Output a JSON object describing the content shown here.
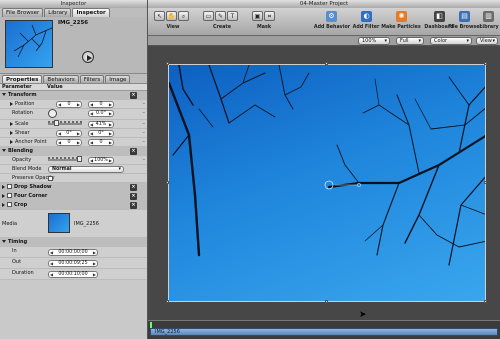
{
  "inspector": {
    "title": "Inspector",
    "top_tabs": [
      "File Browser",
      "Library",
      "Inspector"
    ],
    "clip_name": "IMG_2256",
    "sub_tabs": [
      "Properties",
      "Behaviors",
      "Filters",
      "Image"
    ],
    "columns": {
      "param": "Parameter",
      "value": "Value"
    },
    "transform": {
      "label": "Transform",
      "position": {
        "label": "Position",
        "x": "0",
        "y": "0"
      },
      "rotation": {
        "label": "Rotation",
        "value": "0.0°"
      },
      "scale": {
        "label": "Scale",
        "value": "41%"
      },
      "shear": {
        "label": "Shear",
        "x": "0°",
        "y": "0°"
      },
      "anchor": {
        "label": "Anchor Point",
        "x": "0",
        "y": "0"
      }
    },
    "blending": {
      "label": "Blending",
      "opacity": {
        "label": "Opacity",
        "value": "100%"
      },
      "blend_mode": {
        "label": "Blend Mode",
        "value": "Normal"
      },
      "preserve": {
        "label": "Preserve Opacity"
      }
    },
    "drop_shadow": "Drop Shadow",
    "four_corner": "Four Corner",
    "crop": "Crop",
    "media": {
      "label": "Media",
      "name": "IMG_2256"
    },
    "timing": {
      "label": "Timing",
      "in": {
        "label": "In",
        "value": "00:00:00;00"
      },
      "out": {
        "label": "Out",
        "value": "00:00:09;25"
      },
      "duration": {
        "label": "Duration",
        "value": "00:00:10;00"
      }
    }
  },
  "canvas": {
    "title": "04-Master Project",
    "toolbar": {
      "view_label": "View",
      "create_label": "Create",
      "mask_label": "Mask",
      "add_behavior": "Add Behavior",
      "add_filter": "Add Filter",
      "make_particles": "Make Particles",
      "dashboard": "Dashboard",
      "file_browser": "File Browser",
      "library": "Library"
    },
    "viewbar": {
      "zoom": "100%",
      "resolution": "Full",
      "channel": "Color",
      "view": "View"
    },
    "timeline": {
      "clip_label": "IMG_2256"
    }
  }
}
